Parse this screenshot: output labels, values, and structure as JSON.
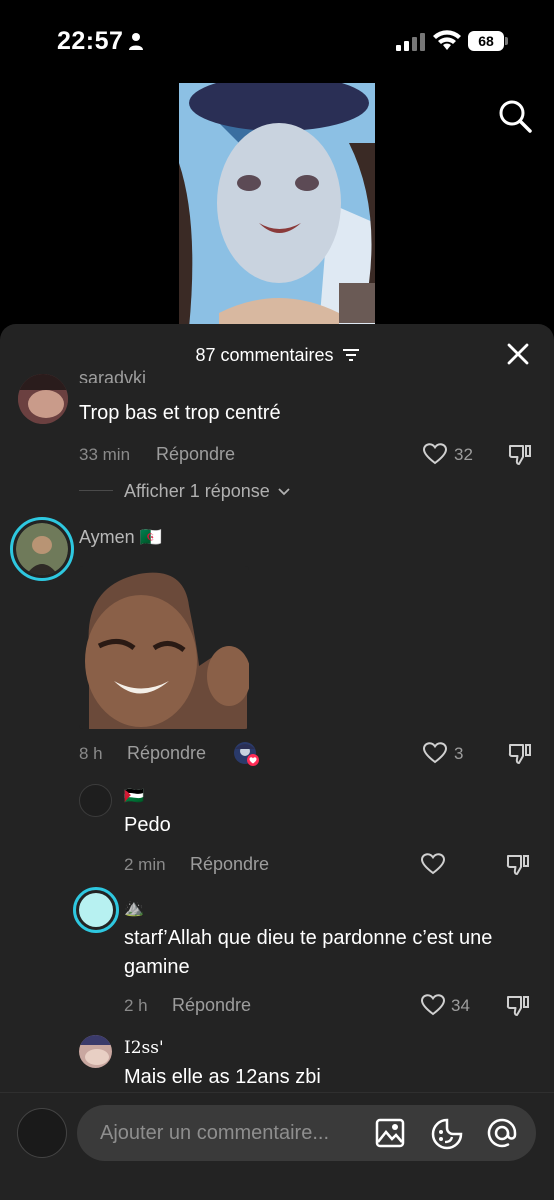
{
  "status_bar": {
    "time": "22:57",
    "battery": "68"
  },
  "comments_header": {
    "count_label": "87 commentaires"
  },
  "comments": [
    {
      "username": "saradvkj",
      "text": "Trop bas et trop centré",
      "time": "33 min",
      "reply_label": "Répondre",
      "likes": "32",
      "view_replies_label": "Afficher 1 réponse"
    },
    {
      "username": "Aymen 🇩🇿",
      "time": "8 h",
      "reply_label": "Répondre",
      "likes": "3",
      "replies": [
        {
          "username": "🇵🇸",
          "text": "Pedo",
          "time": "2 min",
          "reply_label": "Répondre",
          "likes": ""
        },
        {
          "username": "⛰️",
          "text": "starf’Allah que dieu te pardonne c’est une gamine",
          "time": "2 h",
          "reply_label": "Répondre",
          "likes": "34"
        },
        {
          "username": "I2ss'",
          "text": "Mais elle as 12ans zbi"
        }
      ]
    }
  ],
  "input": {
    "placeholder": "Ajouter un commentaire..."
  },
  "colors": {
    "sheet_bg": "#232323",
    "story_ring": "#2ec8e0",
    "like_dot": "#ff2b55"
  }
}
